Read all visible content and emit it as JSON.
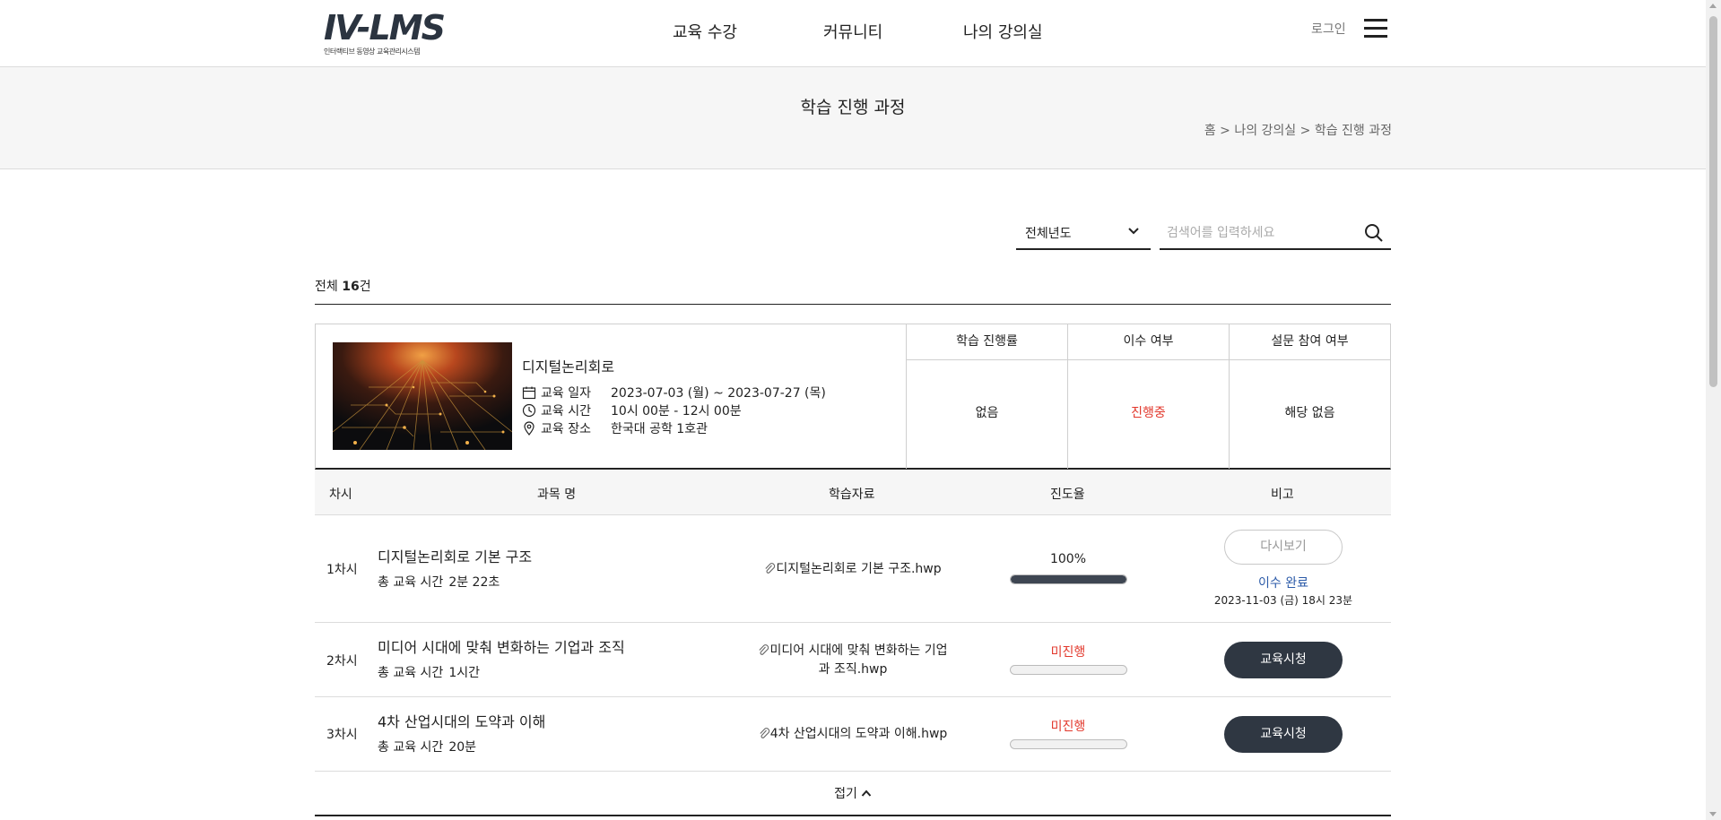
{
  "header": {
    "logo_text": "IV-LMS",
    "logo_subtitle": "인터랙티브 동영상 교육관리시스템",
    "nav": [
      "교육 수강",
      "커뮤니티",
      "나의 강의실"
    ],
    "login_label": "로그인",
    "menu_icon": "hamburger-icon"
  },
  "title_band": {
    "title": "학습 진행 과정",
    "breadcrumb": "홈 > 나의 강의실 > 학습 진행 과정"
  },
  "filter": {
    "year_value": "전체년도",
    "search_placeholder": "검색어를 입력하세요"
  },
  "summary": {
    "prefix": "전체 ",
    "count": "16",
    "suffix": "건"
  },
  "course": {
    "name": "디지털논리회로",
    "date_label": "교육 일자",
    "date_value": "2023-07-03 (월) ~ 2023-07-27 (목)",
    "time_label": "교육 시간",
    "time_value": "10시 00분 - 12시 00분",
    "place_label": "교육 장소",
    "place_value": "한국대 공학 1호관",
    "stats": [
      {
        "header": "학습 진행률",
        "value": "없음"
      },
      {
        "header": "이수 여부",
        "value": "진행중"
      },
      {
        "header": "설문 참여 여부",
        "value": "해당 없음"
      }
    ]
  },
  "lesson_table": {
    "headers": [
      "차시",
      "과목 명",
      "학습자료",
      "진도율",
      "비고"
    ],
    "time_label": "총 교육 시간",
    "rows": [
      {
        "no": "1차시",
        "title": "디지털논리회로 기본 구조",
        "duration": "2분 22초",
        "file_line1": "디지털논리회로 기본 구조.hwp",
        "file_line2": "",
        "progress_text": "100%",
        "progress": 1.0,
        "button": "다시보기",
        "status": "이수 완료",
        "completed_at": "2023-11-03 (금) 18시 23분"
      },
      {
        "no": "2차시",
        "title": "미디어 시대에 맞춰 변화하는 기업과 조직",
        "duration": "1시간",
        "file_line1": "미디어 시대에 맞춰 변화하는 기업",
        "file_line2": "과 조직.hwp",
        "progress_text": "미진행",
        "progress": 0,
        "button": "교육시청"
      },
      {
        "no": "3차시",
        "title": "4차 산업시대의 도약과 이해",
        "duration": "20분",
        "file_line1": "4차 산업시대의 도약과 이해.hwp",
        "file_line2": "",
        "progress_text": "미진행",
        "progress": 0,
        "button": "교육시청"
      }
    ],
    "fold_label": "접기"
  },
  "colors": {
    "accent_red": "#e2372b",
    "done_blue": "#2b5aa8",
    "dark_button": "#2f3742"
  }
}
